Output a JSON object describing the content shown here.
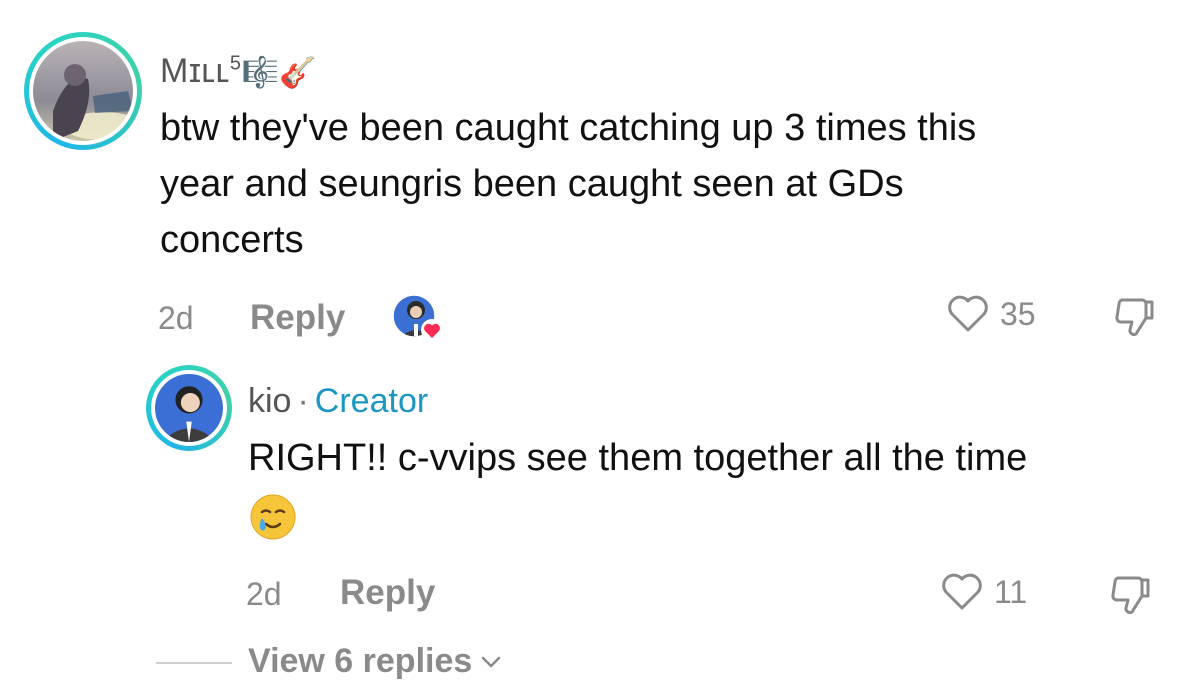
{
  "comment": {
    "username": "Mɪʟʟ",
    "username_sup": "5",
    "username_deco": "🎼🎸",
    "text_line1": "btw they've been caught catching up 3 times this",
    "text_line2": "year and seungris been caught seen at GDs",
    "text_line3": "concerts",
    "time": "2d",
    "reply_label": "Reply",
    "likes": "35"
  },
  "reply": {
    "username": "kio",
    "separator": "·",
    "badge": "Creator",
    "text_line1": "RIGHT!! c-vvips see them together all the time",
    "emoji": "🥲",
    "time": "2d",
    "reply_label": "Reply",
    "likes": "11"
  },
  "view_replies": {
    "label": "View 6 replies"
  },
  "colors": {
    "ring_start": "#1fb6e8",
    "ring_end": "#3fd1a8",
    "creator": "#1b97c2",
    "muted": "#8a8a8a",
    "heart_badge": "#fe2c55"
  }
}
